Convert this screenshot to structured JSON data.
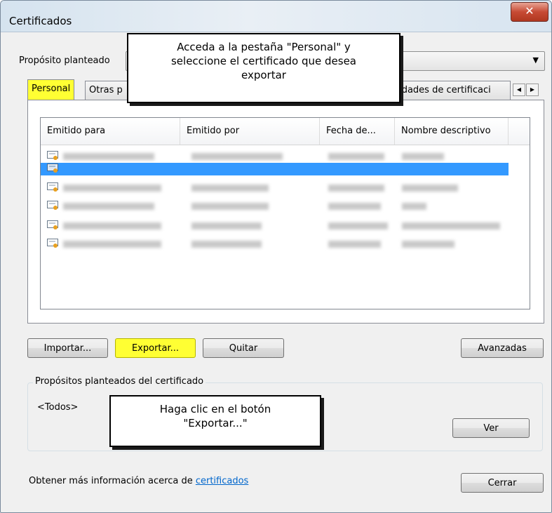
{
  "window": {
    "title": "Certificados"
  },
  "purpose": {
    "label": "Propósito planteado"
  },
  "tabs": {
    "personal": "Personal",
    "otras": "Otras p",
    "entidades": "tidades de certificaci"
  },
  "list": {
    "columns": [
      "Emitido para",
      "Emitido por",
      "Fecha de...",
      "Nombre descriptivo"
    ],
    "selected_row_index": 1
  },
  "buttons": {
    "importar": "Importar...",
    "exportar": "Exportar...",
    "quitar": "Quitar",
    "avanzadas": "Avanzadas",
    "ver": "Ver",
    "cerrar": "Cerrar"
  },
  "group": {
    "title": "Propósitos planteados del certificado",
    "value": "<Todos>"
  },
  "footer": {
    "text": "Obtener más información acerca de ",
    "link": "certificados"
  },
  "callouts": {
    "top_line1": "Acceda a la pestaña \"Personal\" y",
    "top_line2": "seleccione el certificado que desea",
    "top_line3": "exportar",
    "bottom_line1": "Haga clic en el botón",
    "bottom_line2": "\"Exportar...\""
  },
  "colors": {
    "highlight": "#ffff33",
    "selection": "#3399ff",
    "close": "#c74a34"
  }
}
